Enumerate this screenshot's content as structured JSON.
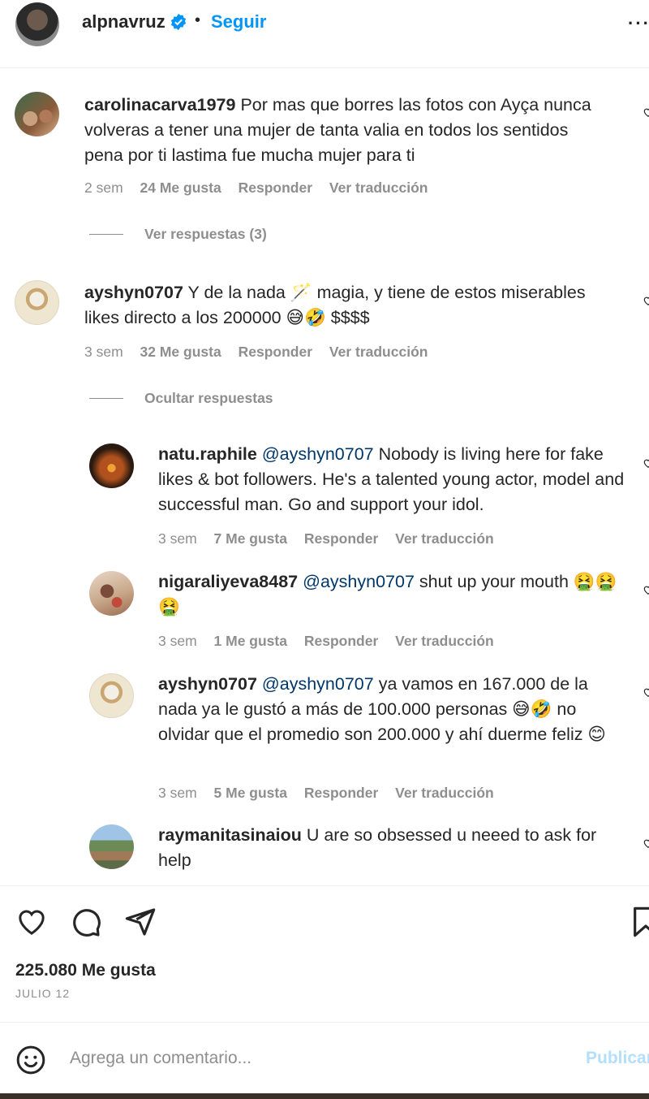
{
  "header": {
    "username": "alpnavruz",
    "separator": "•",
    "follow_label": "Seguir",
    "more_label": "···"
  },
  "comments": [
    {
      "username": "carolinacarva1979",
      "text": "Por mas que borres las fotos con Ayça nunca volveras a tener una mujer de tanta valia en todos los sentidos pena por ti lastima fue mucha mujer para ti",
      "time": "2 sem",
      "likes": "24 Me gusta",
      "reply": "Responder",
      "translate": "Ver traducción",
      "replies_toggle": "Ver respuestas (3)"
    },
    {
      "username": "ayshyn0707",
      "text": "Y de la nada 🪄 magia, y tiene de estos miserables likes directo a los 200000 😅🤣 $$$$",
      "time": "3 sem",
      "likes": "32 Me gusta",
      "reply": "Responder",
      "translate": "Ver traducción",
      "replies_toggle": "Ocultar respuestas"
    }
  ],
  "replies": [
    {
      "username": "natu.raphile",
      "mention": "@ayshyn0707",
      "text": "Nobody is living here for fake likes & bot followers. He's a talented young actor, model and successful man. Go and support your idol.",
      "time": "3 sem",
      "likes": "7 Me gusta",
      "reply": "Responder",
      "translate": "Ver traducción"
    },
    {
      "username": "nigaraliyeva8487",
      "mention": "@ayshyn0707",
      "text": "shut up your mouth 🤮🤮🤮",
      "time": "3 sem",
      "likes": "1 Me gusta",
      "reply": "Responder",
      "translate": "Ver traducción"
    },
    {
      "username": "ayshyn0707",
      "mention": "@ayshyn0707",
      "text": "ya vamos en 167.000 de la nada ya le gustó a más de 100.000 personas 😅🤣 no olvidar que el promedio son 200.000 y ahí duerme feliz 😊",
      "time": "3 sem",
      "likes": "5 Me gusta",
      "reply": "Responder",
      "translate": "Ver traducción"
    },
    {
      "username": "raymanitasinaiou",
      "mention": "",
      "text": "U are so obsessed u neeed to ask for help"
    }
  ],
  "actions": {
    "like_count": "225.080 Me gusta",
    "date": "JULIO 12"
  },
  "add_comment": {
    "placeholder": "Agrega un comentario...",
    "publish_label": "Publicar"
  },
  "colors": {
    "accent": "#0095f6",
    "text": "#262626",
    "muted": "#8e8e8e",
    "mention": "#00376b",
    "publish_disabled": "#b2dffc"
  }
}
